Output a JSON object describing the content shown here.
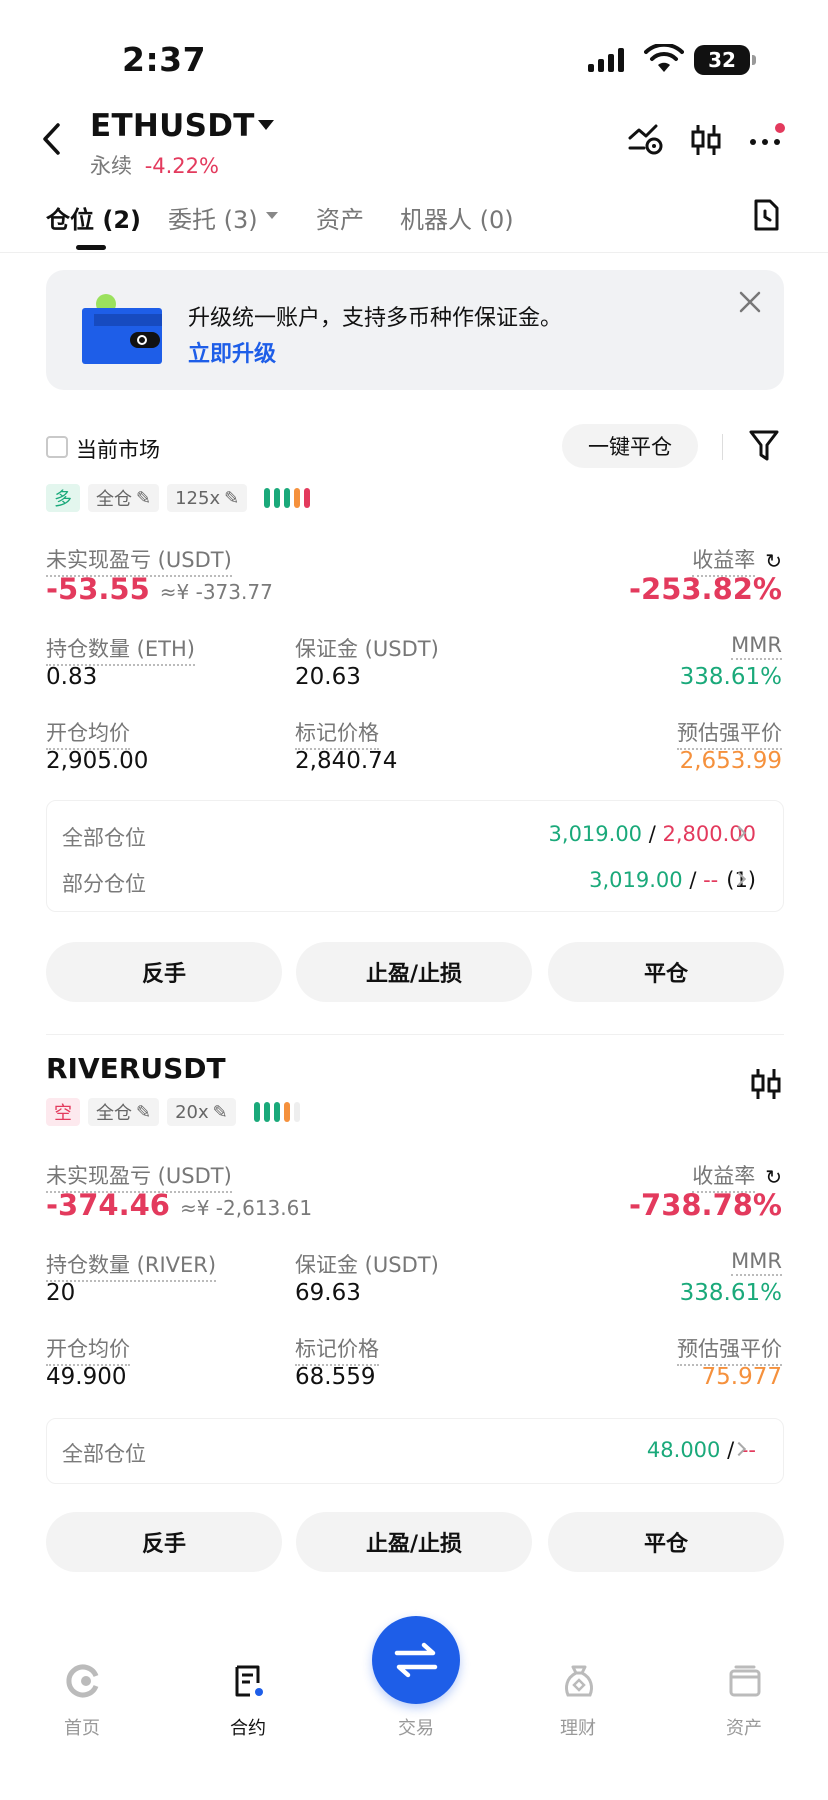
{
  "status_bar": {
    "time": "2:37",
    "battery": "32"
  },
  "header": {
    "symbol": "ETHUSDT",
    "contract_type": "永续",
    "change": "-4.22%"
  },
  "tabs": [
    {
      "label": "仓位 (2)"
    },
    {
      "label": "委托 (3)"
    },
    {
      "label": "资产"
    },
    {
      "label": "机器人 (0)"
    }
  ],
  "banner": {
    "text": "升级统一账户，支持多币种作保证金。",
    "link": "立即升级"
  },
  "filter": {
    "current_market_label": "当前市场",
    "close_all_label": "一键平仓"
  },
  "labels": {
    "unrealized_pnl": "未实现盈亏 (USDT)",
    "roi": "收益率",
    "margin": "保证金 (USDT)",
    "mmr": "MMR",
    "entry_price": "开仓均价",
    "mark_price": "标记价格",
    "liq_price": "预估强平价",
    "full_position": "全部仓位",
    "partial_position": "部分仓位"
  },
  "positions": [
    {
      "side": "多",
      "margin_mode": "全仓",
      "leverage": "125x",
      "pnl": "-53.55",
      "pnl_cny": "≈¥ -373.77",
      "roi": "-253.82%",
      "qty_label": "持仓数量 (ETH)",
      "qty": "0.83",
      "margin": "20.63",
      "mmr": "338.61%",
      "entry": "2,905.00",
      "mark": "2,840.74",
      "liq": "2,653.99",
      "tpsl_full_tp": "3,019.00",
      "tpsl_full_sl": "2,800.00",
      "tpsl_partial_tp": "3,019.00",
      "tpsl_partial_sl": "--",
      "tpsl_partial_count": "(1)",
      "risk_level_bars": [
        "#1aa97a",
        "#1aa97a",
        "#1aa97a",
        "#f5913d",
        "#e33a5d"
      ]
    },
    {
      "symbol": "RIVERUSDT",
      "side": "空",
      "margin_mode": "全仓",
      "leverage": "20x",
      "pnl": "-374.46",
      "pnl_cny": "≈¥ -2,613.61",
      "roi": "-738.78%",
      "qty_label": "持仓数量 (RIVER)",
      "qty": "20",
      "margin": "69.63",
      "mmr": "338.61%",
      "entry": "49.900",
      "mark": "68.559",
      "liq": "75.977",
      "tpsl_full_tp": "48.000",
      "tpsl_full_sl": "--",
      "risk_level_bars": [
        "#1aa97a",
        "#1aa97a",
        "#1aa97a",
        "#f5913d",
        "#eeeeee"
      ]
    }
  ],
  "actions": {
    "reverse": "反手",
    "tpsl": "止盈/止损",
    "close": "平仓"
  },
  "bottom_nav": [
    {
      "label": "首页"
    },
    {
      "label": "合约"
    },
    {
      "label": "交易"
    },
    {
      "label": "理财"
    },
    {
      "label": "资产"
    }
  ],
  "colors": {
    "accent": "#1e5ee8",
    "up": "#1aa97a",
    "down": "#e33a5d",
    "warning": "#f5913d"
  }
}
